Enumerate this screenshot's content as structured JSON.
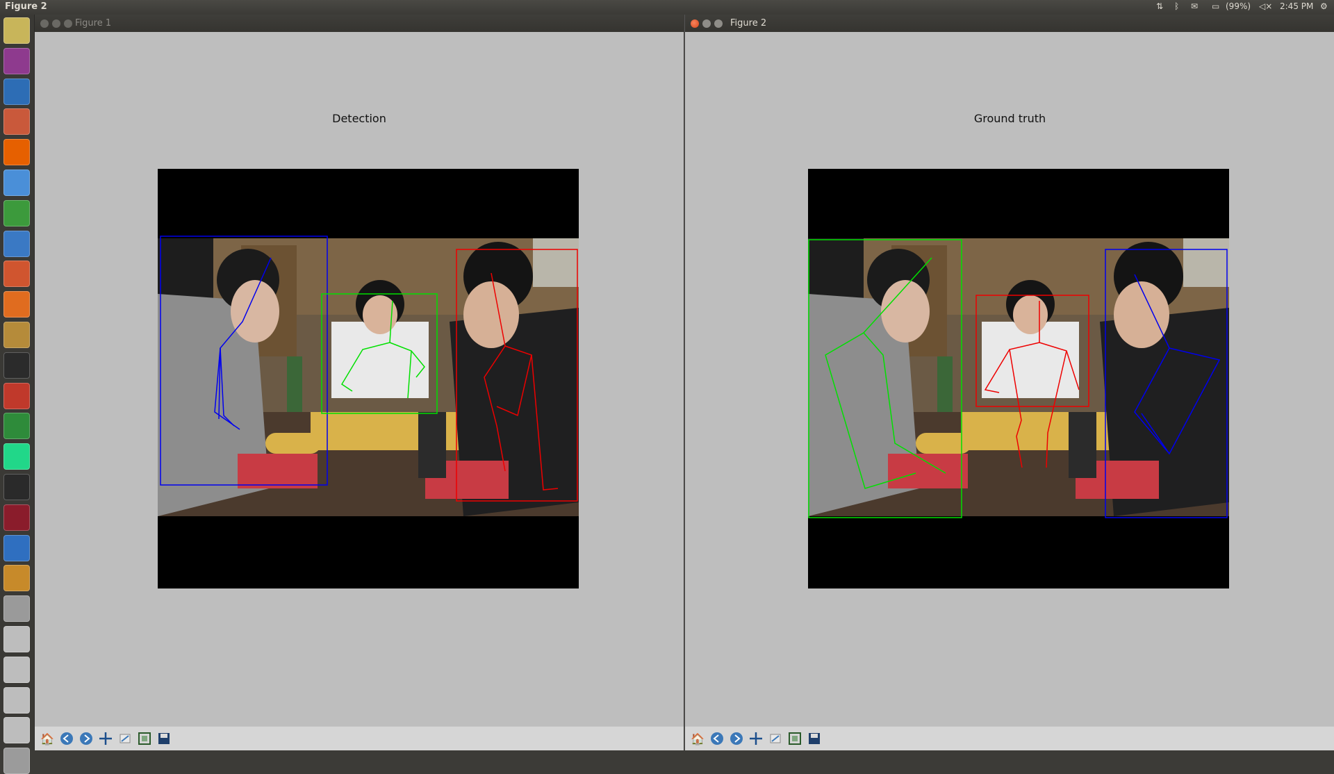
{
  "topbar": {
    "title": "Figure 2",
    "battery": "(99%)",
    "time": "2:45 PM"
  },
  "launcher": {
    "items": [
      {
        "name": "dash-home-icon",
        "color": "#c8b55a"
      },
      {
        "name": "video-app-icon",
        "color": "#8e3a8e"
      },
      {
        "name": "ruler-app-icon",
        "color": "#2d6db5"
      },
      {
        "name": "file-manager-icon",
        "color": "#c9593b"
      },
      {
        "name": "firefox-icon",
        "color": "#e66000"
      },
      {
        "name": "chromium-icon",
        "color": "#4a8fd8"
      },
      {
        "name": "spreadsheet-icon",
        "color": "#3c9a3c"
      },
      {
        "name": "writer-icon",
        "color": "#3a79c4"
      },
      {
        "name": "impress-icon",
        "color": "#d0552f"
      },
      {
        "name": "software-center-icon",
        "color": "#e06c1f"
      },
      {
        "name": "archive-icon",
        "color": "#b58b3a"
      },
      {
        "name": "terminal-icon",
        "color": "#2b2b2b"
      },
      {
        "name": "matlab-icon",
        "color": "#c0392b"
      },
      {
        "name": "globe-app-icon",
        "color": "#2e8b3a"
      },
      {
        "name": "pycharm-icon",
        "color": "#21d789"
      },
      {
        "name": "system-monitor-icon",
        "color": "#2a2a2a"
      },
      {
        "name": "red-app-icon",
        "color": "#8a1c2b"
      },
      {
        "name": "bluetooth-icon",
        "color": "#2f6fc0"
      },
      {
        "name": "oscilloscope-icon",
        "color": "#c78a2a"
      },
      {
        "name": "help-icon",
        "color": "#9a9a9a"
      },
      {
        "name": "drive-icon-1",
        "color": "#bdbdbd"
      },
      {
        "name": "drive-icon-2",
        "color": "#bdbdbd"
      },
      {
        "name": "drive-icon-3",
        "color": "#bdbdbd"
      },
      {
        "name": "drive-icon-4",
        "color": "#bdbdbd"
      },
      {
        "name": "trash-icon",
        "color": "#9b9b9b"
      }
    ]
  },
  "figure1": {
    "window_title": "Figure 1",
    "plot_title": "Detection"
  },
  "figure2": {
    "window_title": "Figure 2",
    "plot_title": "Ground truth"
  },
  "colors": {
    "blue": "#0000ee",
    "green": "#00e000",
    "red": "#ee0000"
  }
}
